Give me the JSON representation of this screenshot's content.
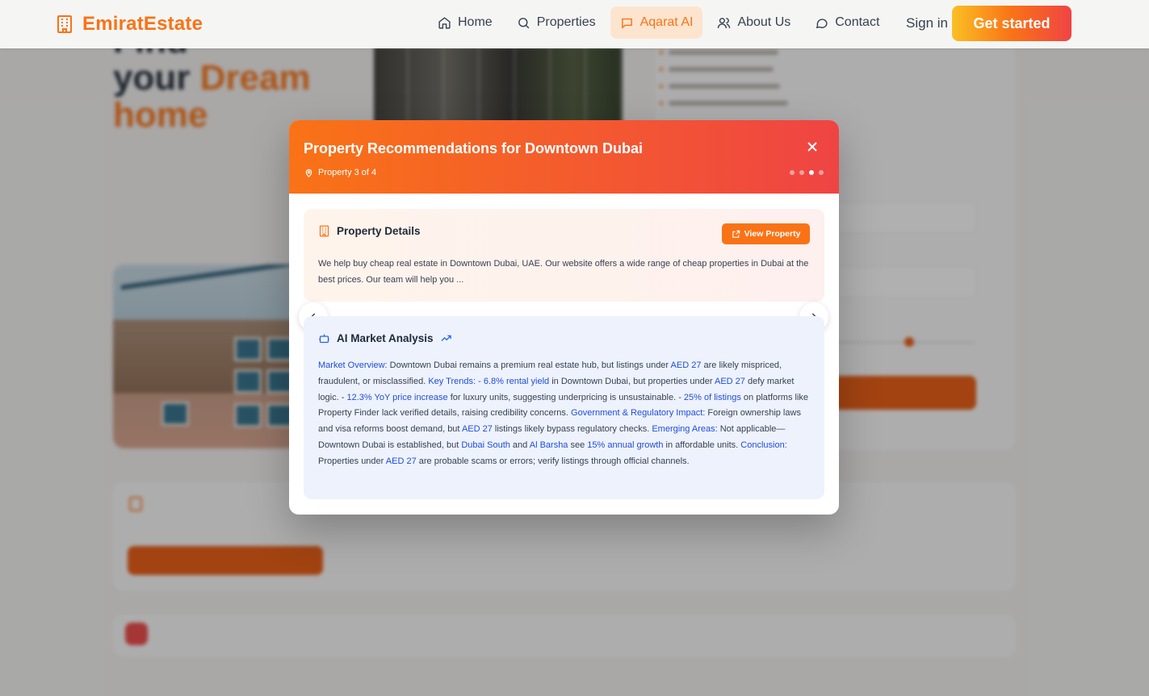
{
  "navbar": {
    "brand": "EmiratEstate",
    "items": [
      {
        "label": "Home",
        "icon": "home-icon"
      },
      {
        "label": "Properties",
        "icon": "search-icon"
      },
      {
        "label": "Aqarat AI",
        "icon": "chat-bot-icon",
        "active": true
      },
      {
        "label": "About Us",
        "icon": "users-icon"
      },
      {
        "label": "Contact",
        "icon": "message-icon"
      }
    ],
    "signin": "Sign in",
    "get_started": "Get started"
  },
  "background": {
    "hero_line1": "Find",
    "hero_line2": "your",
    "hero_accent1": "Dream",
    "hero_accent2": "home"
  },
  "modal": {
    "title": "Property Recommendations for Downtown Dubai",
    "subtitle": "Property 3 of 4",
    "total_dots": 4,
    "active_dot": 3,
    "details": {
      "heading": "Property Details",
      "view_button": "View Property",
      "text": "We help buy cheap real estate in Downtown Dubai, UAE. Our website offers a wide range of cheap properties in Dubai at the best prices. Our team will help you ..."
    },
    "ai": {
      "heading": "AI Market Analysis",
      "segments": [
        {
          "t": "Market Overview:",
          "h": true
        },
        {
          "t": " Downtown Dubai remains a premium real estate hub, but listings under "
        },
        {
          "t": "AED 27",
          "h": true
        },
        {
          "t": " are likely mispriced, fraudulent, or misclassified. "
        },
        {
          "t": "Key Trends:",
          "h": true
        },
        {
          "t": " "
        },
        {
          "t": "- 6.8% rental yield",
          "h": true
        },
        {
          "t": " in Downtown Dubai, but properties under "
        },
        {
          "t": "AED 27",
          "h": true
        },
        {
          "t": " defy market logic. - "
        },
        {
          "t": "12.3% YoY price increase",
          "h": true
        },
        {
          "t": " for luxury units, suggesting underpricing is unsustainable. - "
        },
        {
          "t": "25% of listings",
          "h": true
        },
        {
          "t": " on platforms like Property Finder lack verified details, raising credibility concerns. "
        },
        {
          "t": "Government & Regulatory Impact:",
          "h": true
        },
        {
          "t": " Foreign ownership laws and visa reforms boost demand, but "
        },
        {
          "t": "AED 27",
          "h": true
        },
        {
          "t": " listings likely bypass regulatory checks. "
        },
        {
          "t": "Emerging Areas:",
          "h": true
        },
        {
          "t": " Not applicable—Downtown Dubai is established, but "
        },
        {
          "t": "Dubai South",
          "h": true
        },
        {
          "t": " and "
        },
        {
          "t": "Al Barsha",
          "h": true
        },
        {
          "t": " see "
        },
        {
          "t": "15% annual growth",
          "h": true
        },
        {
          "t": " in affordable units. "
        },
        {
          "t": "Conclusion:",
          "h": true
        },
        {
          "t": " Properties under "
        },
        {
          "t": "AED 27",
          "h": true
        },
        {
          "t": " are probable scams or errors; verify listings through official channels."
        }
      ]
    }
  },
  "colors": {
    "accent": "#f97316",
    "accent_red": "#ef4444",
    "highlight": "#1d4ed8"
  }
}
